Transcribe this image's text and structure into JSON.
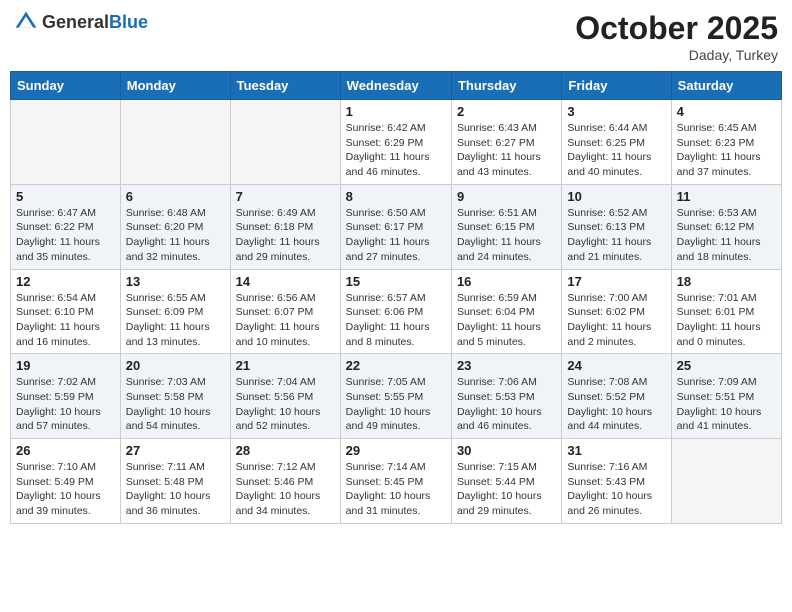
{
  "header": {
    "logo_general": "General",
    "logo_blue": "Blue",
    "month": "October 2025",
    "location": "Daday, Turkey"
  },
  "days_of_week": [
    "Sunday",
    "Monday",
    "Tuesday",
    "Wednesday",
    "Thursday",
    "Friday",
    "Saturday"
  ],
  "weeks": [
    {
      "days": [
        {
          "num": "",
          "info": ""
        },
        {
          "num": "",
          "info": ""
        },
        {
          "num": "",
          "info": ""
        },
        {
          "num": "1",
          "info": "Sunrise: 6:42 AM\nSunset: 6:29 PM\nDaylight: 11 hours and 46 minutes."
        },
        {
          "num": "2",
          "info": "Sunrise: 6:43 AM\nSunset: 6:27 PM\nDaylight: 11 hours and 43 minutes."
        },
        {
          "num": "3",
          "info": "Sunrise: 6:44 AM\nSunset: 6:25 PM\nDaylight: 11 hours and 40 minutes."
        },
        {
          "num": "4",
          "info": "Sunrise: 6:45 AM\nSunset: 6:23 PM\nDaylight: 11 hours and 37 minutes."
        }
      ]
    },
    {
      "days": [
        {
          "num": "5",
          "info": "Sunrise: 6:47 AM\nSunset: 6:22 PM\nDaylight: 11 hours and 35 minutes."
        },
        {
          "num": "6",
          "info": "Sunrise: 6:48 AM\nSunset: 6:20 PM\nDaylight: 11 hours and 32 minutes."
        },
        {
          "num": "7",
          "info": "Sunrise: 6:49 AM\nSunset: 6:18 PM\nDaylight: 11 hours and 29 minutes."
        },
        {
          "num": "8",
          "info": "Sunrise: 6:50 AM\nSunset: 6:17 PM\nDaylight: 11 hours and 27 minutes."
        },
        {
          "num": "9",
          "info": "Sunrise: 6:51 AM\nSunset: 6:15 PM\nDaylight: 11 hours and 24 minutes."
        },
        {
          "num": "10",
          "info": "Sunrise: 6:52 AM\nSunset: 6:13 PM\nDaylight: 11 hours and 21 minutes."
        },
        {
          "num": "11",
          "info": "Sunrise: 6:53 AM\nSunset: 6:12 PM\nDaylight: 11 hours and 18 minutes."
        }
      ]
    },
    {
      "days": [
        {
          "num": "12",
          "info": "Sunrise: 6:54 AM\nSunset: 6:10 PM\nDaylight: 11 hours and 16 minutes."
        },
        {
          "num": "13",
          "info": "Sunrise: 6:55 AM\nSunset: 6:09 PM\nDaylight: 11 hours and 13 minutes."
        },
        {
          "num": "14",
          "info": "Sunrise: 6:56 AM\nSunset: 6:07 PM\nDaylight: 11 hours and 10 minutes."
        },
        {
          "num": "15",
          "info": "Sunrise: 6:57 AM\nSunset: 6:06 PM\nDaylight: 11 hours and 8 minutes."
        },
        {
          "num": "16",
          "info": "Sunrise: 6:59 AM\nSunset: 6:04 PM\nDaylight: 11 hours and 5 minutes."
        },
        {
          "num": "17",
          "info": "Sunrise: 7:00 AM\nSunset: 6:02 PM\nDaylight: 11 hours and 2 minutes."
        },
        {
          "num": "18",
          "info": "Sunrise: 7:01 AM\nSunset: 6:01 PM\nDaylight: 11 hours and 0 minutes."
        }
      ]
    },
    {
      "days": [
        {
          "num": "19",
          "info": "Sunrise: 7:02 AM\nSunset: 5:59 PM\nDaylight: 10 hours and 57 minutes."
        },
        {
          "num": "20",
          "info": "Sunrise: 7:03 AM\nSunset: 5:58 PM\nDaylight: 10 hours and 54 minutes."
        },
        {
          "num": "21",
          "info": "Sunrise: 7:04 AM\nSunset: 5:56 PM\nDaylight: 10 hours and 52 minutes."
        },
        {
          "num": "22",
          "info": "Sunrise: 7:05 AM\nSunset: 5:55 PM\nDaylight: 10 hours and 49 minutes."
        },
        {
          "num": "23",
          "info": "Sunrise: 7:06 AM\nSunset: 5:53 PM\nDaylight: 10 hours and 46 minutes."
        },
        {
          "num": "24",
          "info": "Sunrise: 7:08 AM\nSunset: 5:52 PM\nDaylight: 10 hours and 44 minutes."
        },
        {
          "num": "25",
          "info": "Sunrise: 7:09 AM\nSunset: 5:51 PM\nDaylight: 10 hours and 41 minutes."
        }
      ]
    },
    {
      "days": [
        {
          "num": "26",
          "info": "Sunrise: 7:10 AM\nSunset: 5:49 PM\nDaylight: 10 hours and 39 minutes."
        },
        {
          "num": "27",
          "info": "Sunrise: 7:11 AM\nSunset: 5:48 PM\nDaylight: 10 hours and 36 minutes."
        },
        {
          "num": "28",
          "info": "Sunrise: 7:12 AM\nSunset: 5:46 PM\nDaylight: 10 hours and 34 minutes."
        },
        {
          "num": "29",
          "info": "Sunrise: 7:14 AM\nSunset: 5:45 PM\nDaylight: 10 hours and 31 minutes."
        },
        {
          "num": "30",
          "info": "Sunrise: 7:15 AM\nSunset: 5:44 PM\nDaylight: 10 hours and 29 minutes."
        },
        {
          "num": "31",
          "info": "Sunrise: 7:16 AM\nSunset: 5:43 PM\nDaylight: 10 hours and 26 minutes."
        },
        {
          "num": "",
          "info": ""
        }
      ]
    }
  ]
}
